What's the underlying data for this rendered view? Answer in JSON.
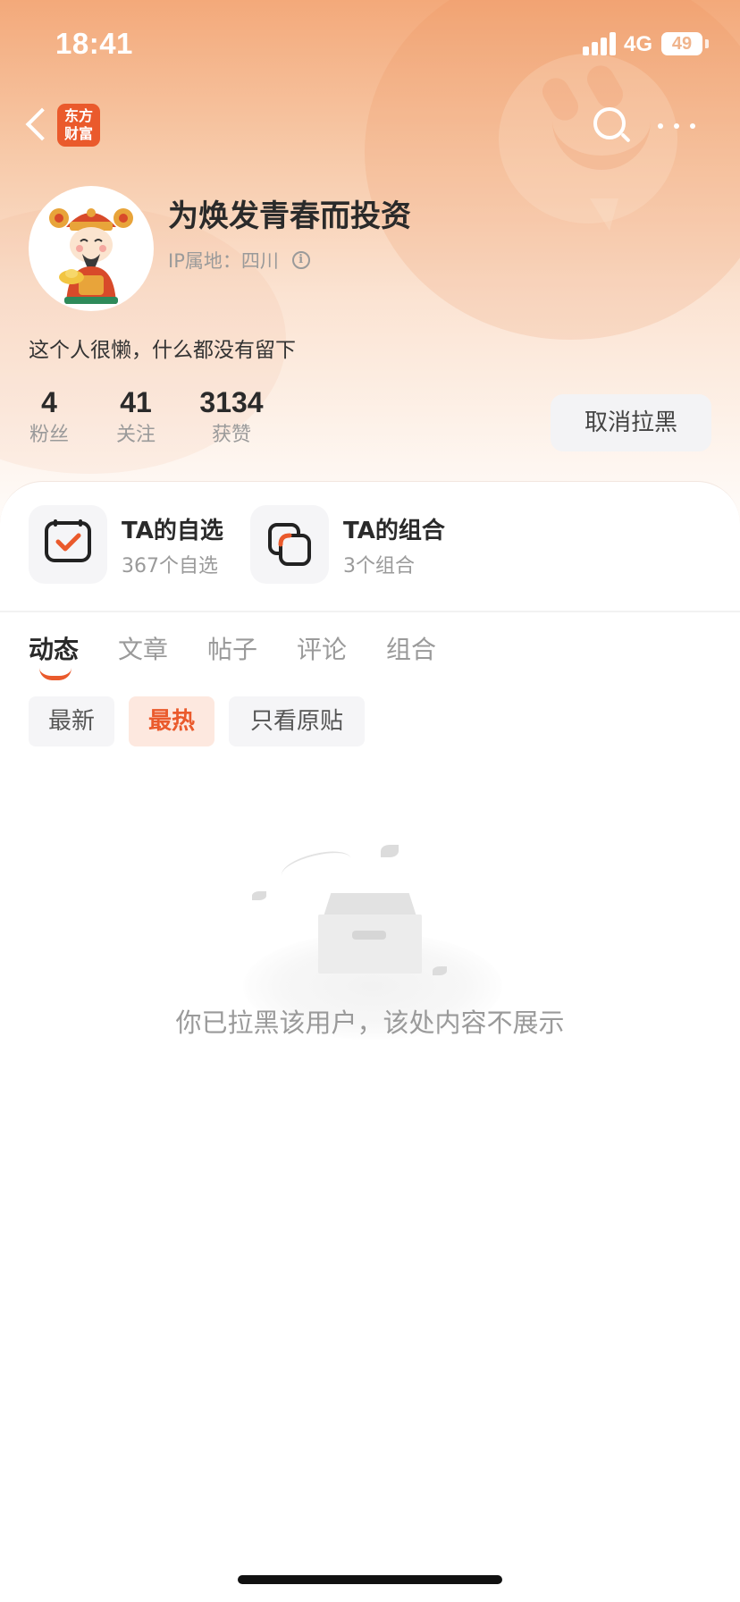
{
  "status_bar": {
    "time": "18:41",
    "network": "4G",
    "battery": "49"
  },
  "nav": {
    "brand_line1": "东方",
    "brand_line2": "财富",
    "brand_color": "#ea5a2c"
  },
  "profile": {
    "name": "为焕发青春而投资",
    "ip_label": "IP属地：四川",
    "bio": "这个人很懒，什么都没有留下"
  },
  "stats": [
    {
      "value": "4",
      "label": "粉丝"
    },
    {
      "value": "41",
      "label": "关注"
    },
    {
      "value": "3134",
      "label": "获赞"
    }
  ],
  "actions": {
    "unblock_label": "取消拉黑"
  },
  "quick_links": [
    {
      "title": "TA的自选",
      "subtitle": "367个自选",
      "icon": "watchlist-check-icon"
    },
    {
      "title": "TA的组合",
      "subtitle": "3个组合",
      "icon": "portfolio-icon"
    }
  ],
  "tabs": [
    {
      "label": "动态",
      "active": true
    },
    {
      "label": "文章",
      "active": false
    },
    {
      "label": "帖子",
      "active": false
    },
    {
      "label": "评论",
      "active": false
    },
    {
      "label": "组合",
      "active": false
    }
  ],
  "filters": [
    {
      "label": "最新",
      "active": false
    },
    {
      "label": "最热",
      "active": true
    },
    {
      "label": "只看原贴",
      "active": false
    }
  ],
  "empty_state": {
    "message": "你已拉黑该用户，该处内容不展示"
  },
  "colors": {
    "accent": "#ea5a2c",
    "hero_top": "#f3a97a"
  }
}
